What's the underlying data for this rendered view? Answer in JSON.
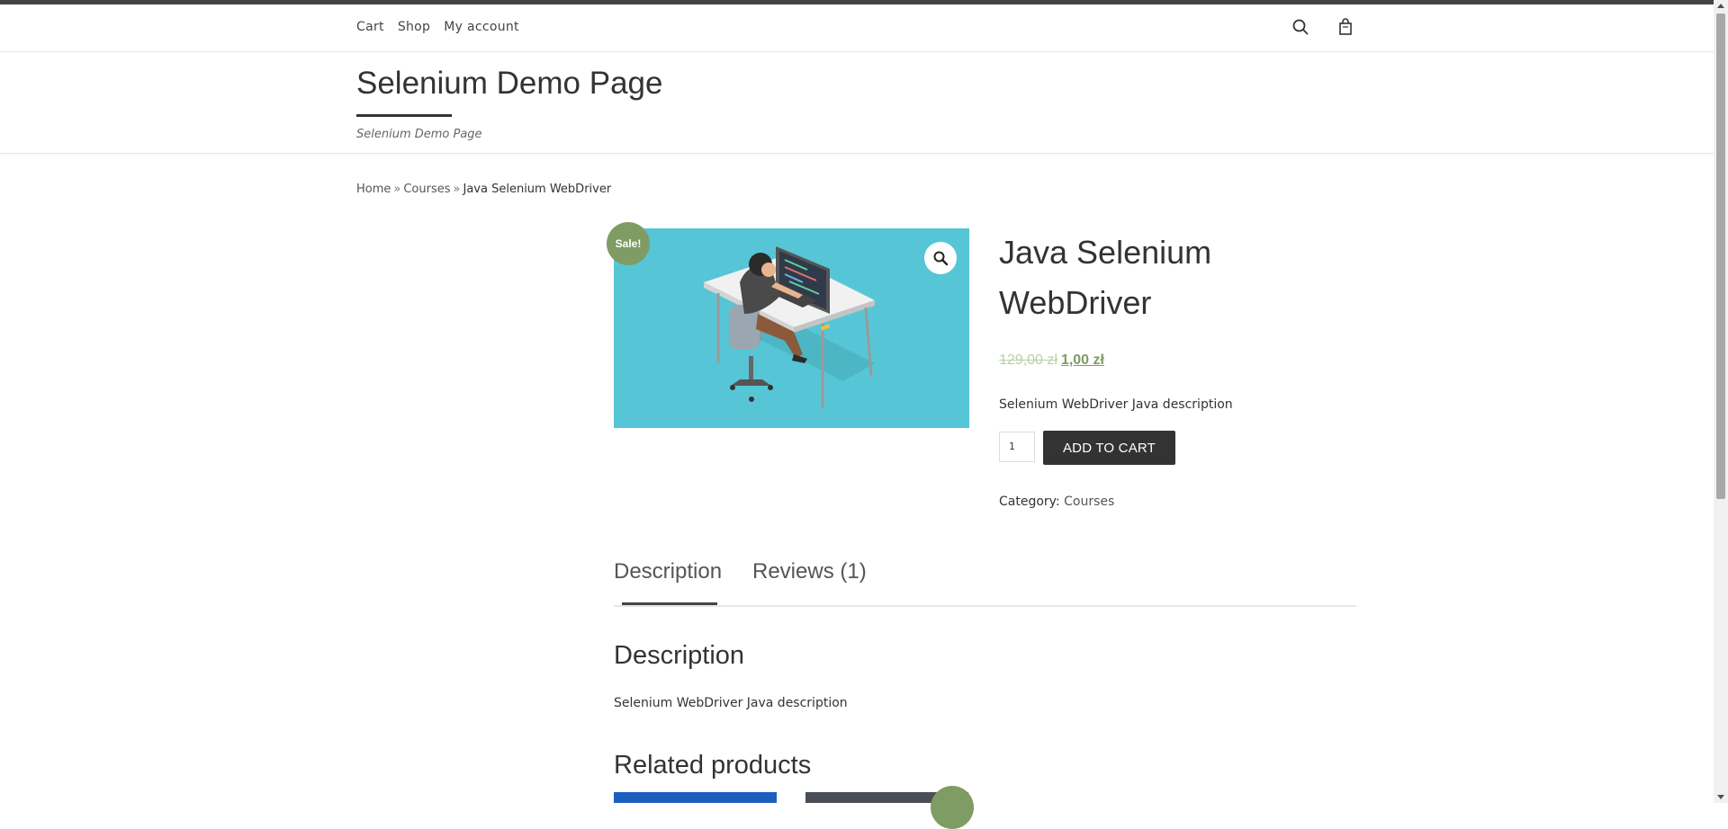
{
  "nav": {
    "links": [
      "Cart",
      "Shop",
      "My account"
    ],
    "icons": [
      "search-icon",
      "shopping-bag-icon"
    ]
  },
  "site": {
    "title": "Selenium Demo Page",
    "tagline": "Selenium Demo Page"
  },
  "breadcrumb": {
    "items": [
      "Home",
      "Courses"
    ],
    "separator": "»",
    "current": "Java Selenium WebDriver"
  },
  "product": {
    "sale_badge": "Sale!",
    "title": "Java Selenium WebDriver",
    "old_price": "129,00 zł",
    "new_price": "1,00 zł",
    "short_description": "Selenium WebDriver Java description",
    "quantity": "1",
    "add_to_cart_label": "ADD TO CART",
    "category_label": "Category:",
    "category": "Courses"
  },
  "tabs": {
    "items": [
      "Description",
      "Reviews (1)"
    ],
    "active": "Description"
  },
  "description": {
    "heading": "Description",
    "text": "Selenium WebDriver Java description"
  },
  "related": {
    "heading": "Related products"
  },
  "colors": {
    "accent": "#7e9c63",
    "dark": "#333333",
    "image_bg": "#56c6d6"
  }
}
